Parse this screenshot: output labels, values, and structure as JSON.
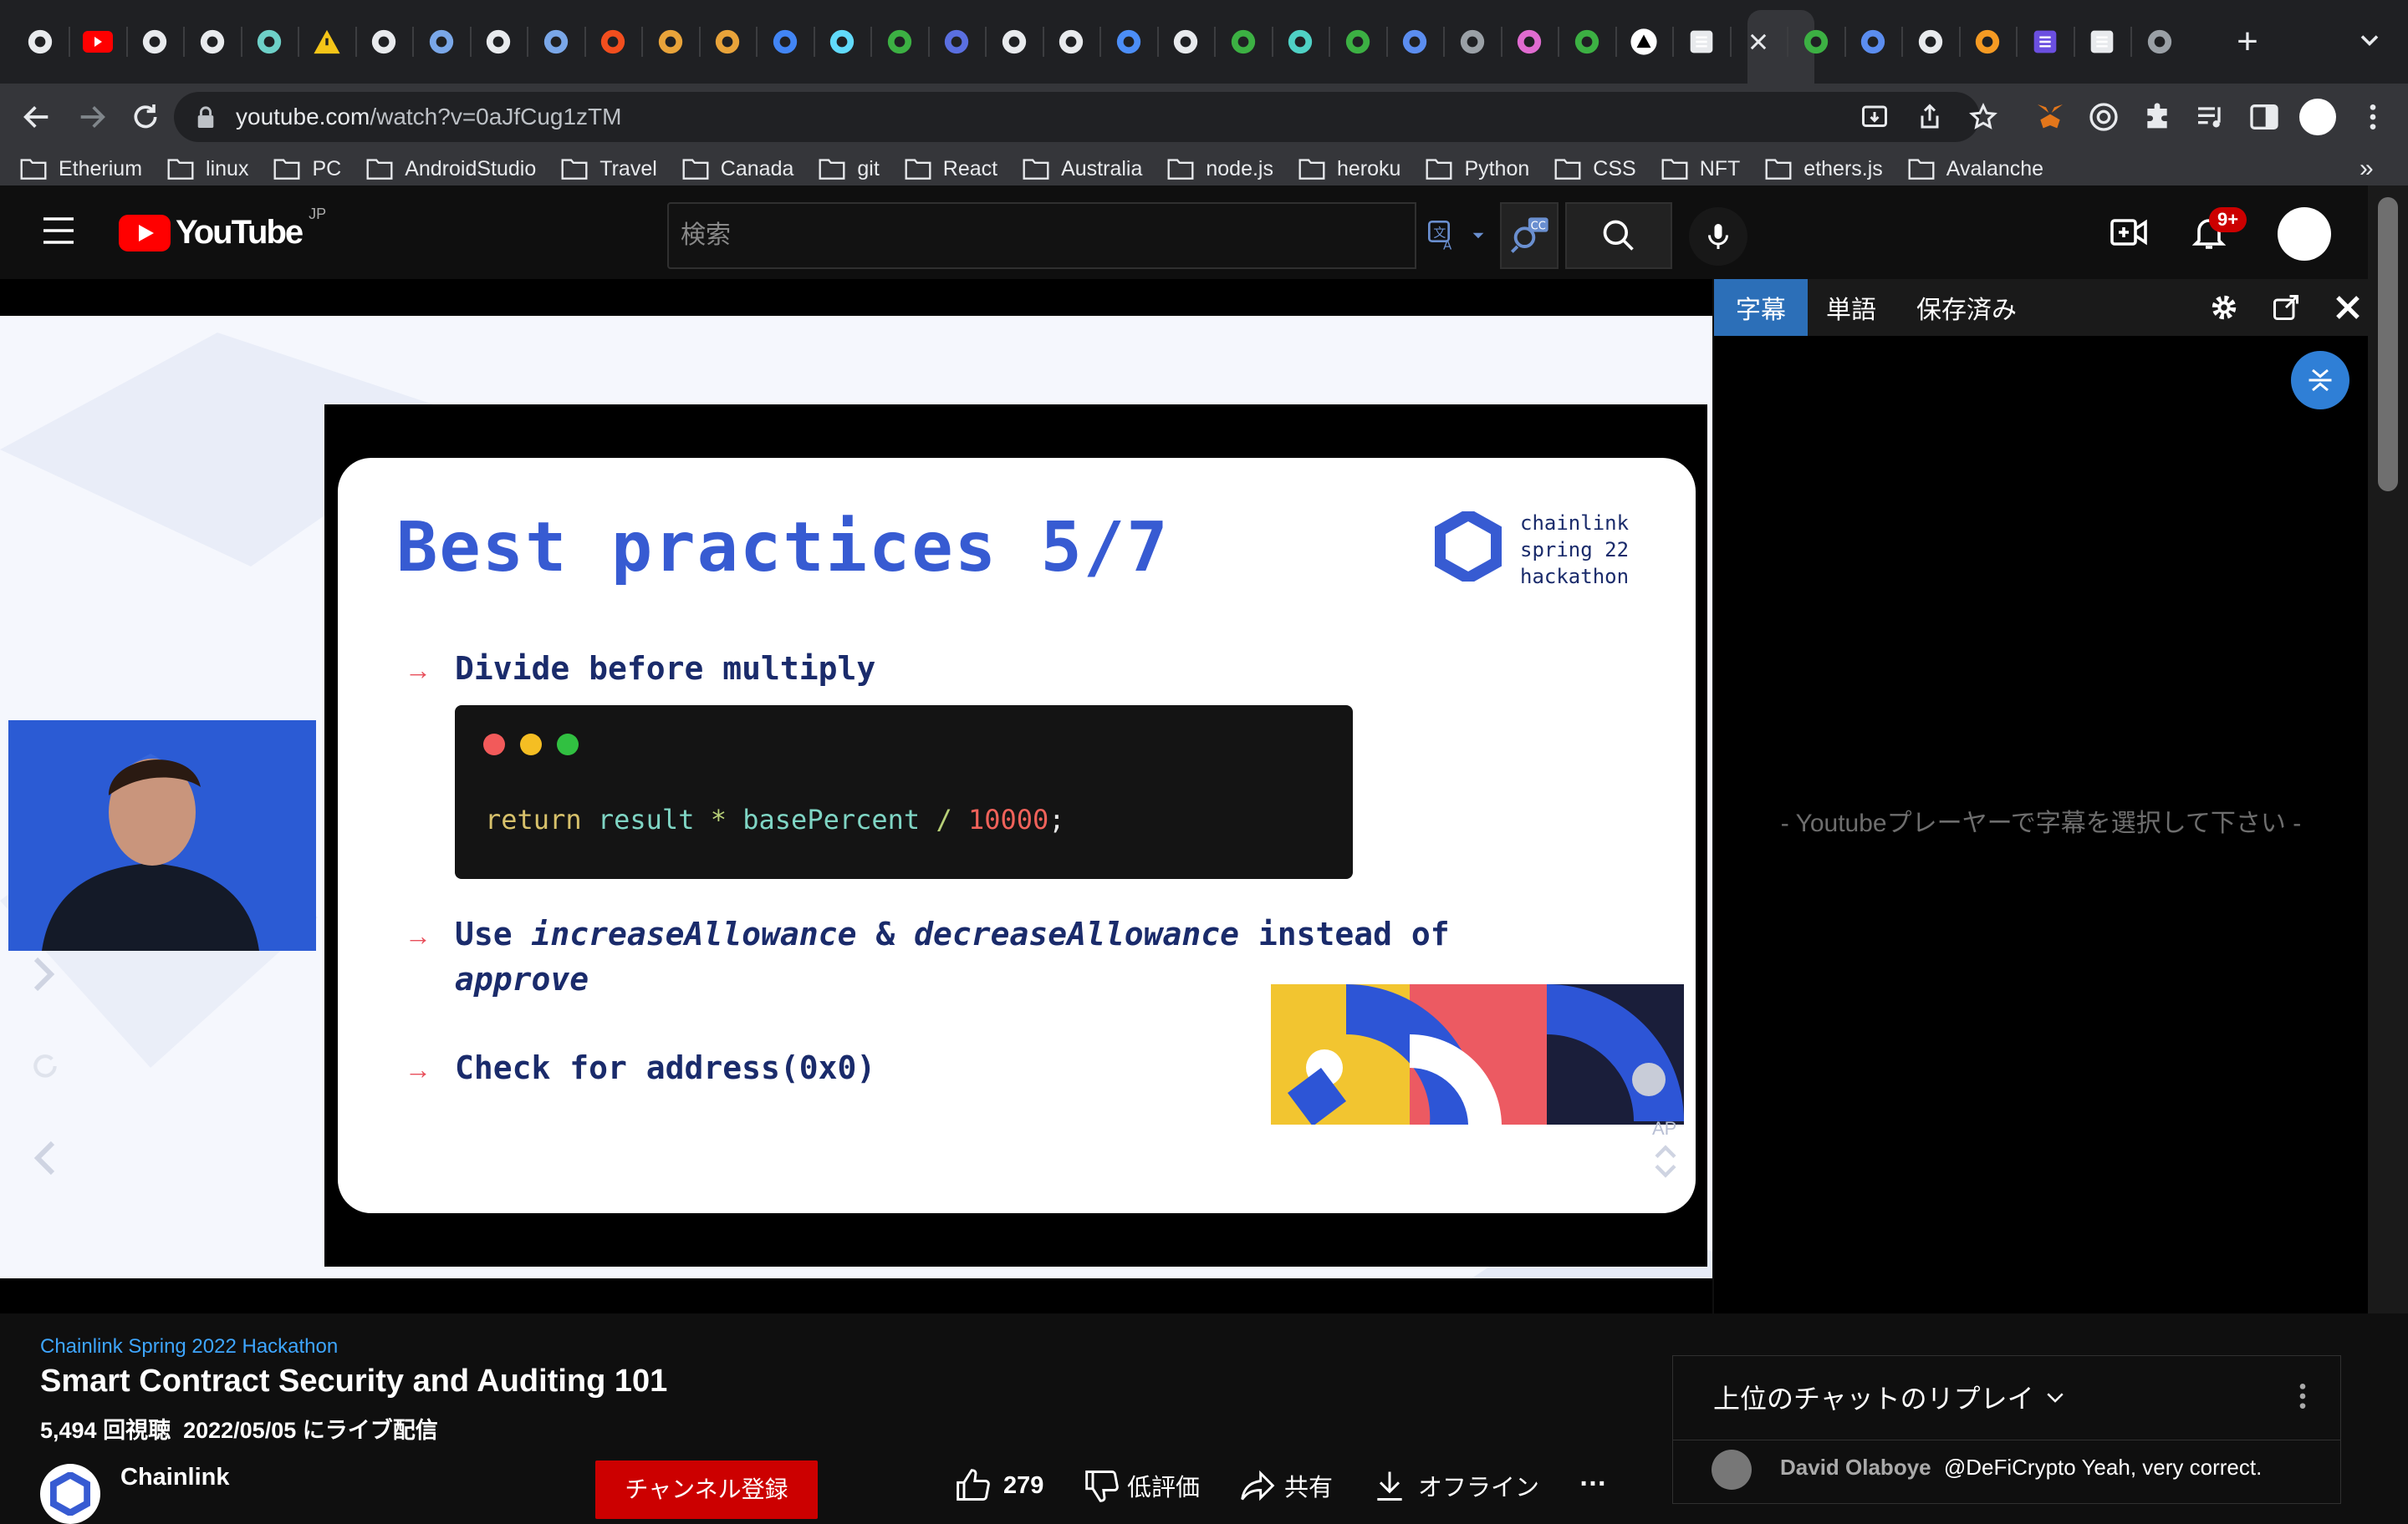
{
  "browser": {
    "tabs": [
      {
        "icon": "github-icon"
      },
      {
        "icon": "youtube-icon"
      },
      {
        "icon": "codesandbox-icon"
      },
      {
        "icon": "github-icon"
      },
      {
        "icon": "avalanche-icon"
      },
      {
        "icon": "warning-icon"
      },
      {
        "icon": "notes-icon"
      },
      {
        "icon": "butterfly-icon"
      },
      {
        "icon": "chrome-icon"
      },
      {
        "icon": "butterfly-icon"
      },
      {
        "icon": "figma-icon"
      },
      {
        "icon": "donut-icon"
      },
      {
        "icon": "donut-icon"
      },
      {
        "icon": "google-icon"
      },
      {
        "icon": "react-icon"
      },
      {
        "icon": "green-circle-icon"
      },
      {
        "icon": "moon-icon"
      },
      {
        "icon": "github-icon"
      },
      {
        "icon": "notion-icon"
      },
      {
        "icon": "compass-icon"
      },
      {
        "icon": "chrome-icon"
      },
      {
        "icon": "green-circle-icon"
      },
      {
        "icon": "bolt-icon"
      },
      {
        "icon": "green-circle-icon"
      },
      {
        "icon": "slash-icon"
      },
      {
        "icon": "globe-icon"
      },
      {
        "icon": "color-wheel-icon"
      },
      {
        "icon": "green-circle-icon"
      },
      {
        "icon": "triangle-icon"
      },
      {
        "icon": "document-icon"
      },
      {
        "icon": "close-icon"
      },
      {
        "icon": "green-circle-icon"
      },
      {
        "icon": "slash-icon"
      },
      {
        "icon": "github-icon"
      },
      {
        "icon": "in-icon"
      },
      {
        "icon": "list-icon"
      },
      {
        "icon": "image-icon"
      },
      {
        "icon": "globe-icon"
      }
    ],
    "new_tab_symbol": "+",
    "url_domain": "youtube.com",
    "url_path": "/watch?v=0aJfCug1zTM",
    "bookmarks": [
      "Etherium",
      "linux",
      "PC",
      "AndroidStudio",
      "Travel",
      "Canada",
      "git",
      "React",
      "Australia",
      "node.js",
      "heroku",
      "Python",
      "CSS",
      "NFT",
      "ethers.js",
      "Avalanche"
    ],
    "bookmarks_overflow": "»"
  },
  "youtube": {
    "logo_text": "YouTube",
    "region": "JP",
    "search_placeholder": "検索",
    "notification_count": "9+"
  },
  "slide": {
    "title": "Best practices 5/7",
    "brand": [
      "chainlink",
      "spring 22",
      "hackathon"
    ],
    "bullet1": "Divide before multiply",
    "code": {
      "kw": "return",
      "a": "result",
      "op1": "*",
      "b": "basePercent",
      "op2": "/",
      "num": "10000",
      "end": ";"
    },
    "bullet2_a": "Use ",
    "bullet2_b": "increaseAllowance",
    "bullet2_c": " & ",
    "bullet2_d": "decreaseAllowance",
    "bullet2_e": " instead of",
    "bullet2_f": "approve",
    "bullet3": "Check for address(0x0)",
    "watermark": "AP"
  },
  "subtitle_panel": {
    "tabs": [
      "字幕",
      "単語",
      "保存済み"
    ],
    "message": "- Youtubeプレーヤーで字幕を選択して下さい -"
  },
  "video": {
    "playlist": "Chainlink Spring 2022 Hackathon",
    "title": "Smart Contract Security and Auditing 101",
    "views": "5,494 回視聴",
    "date": "2022/05/05 にライブ配信",
    "channel": "Chainlink",
    "subscribe": "チャンネル登録",
    "likes": "279",
    "dislike": "低評価",
    "share": "共有",
    "offline": "オフライン",
    "more": "…"
  },
  "chat": {
    "header": "上位のチャットのリプレイ",
    "author": "David Olaboye",
    "message": "@DeFiCrypto Yeah, very correct."
  },
  "colors": {
    "accent": "#375bd2",
    "yt_red": "#ff0000",
    "subscribe_red": "#cc0000",
    "link_blue": "#3ea6ff"
  }
}
